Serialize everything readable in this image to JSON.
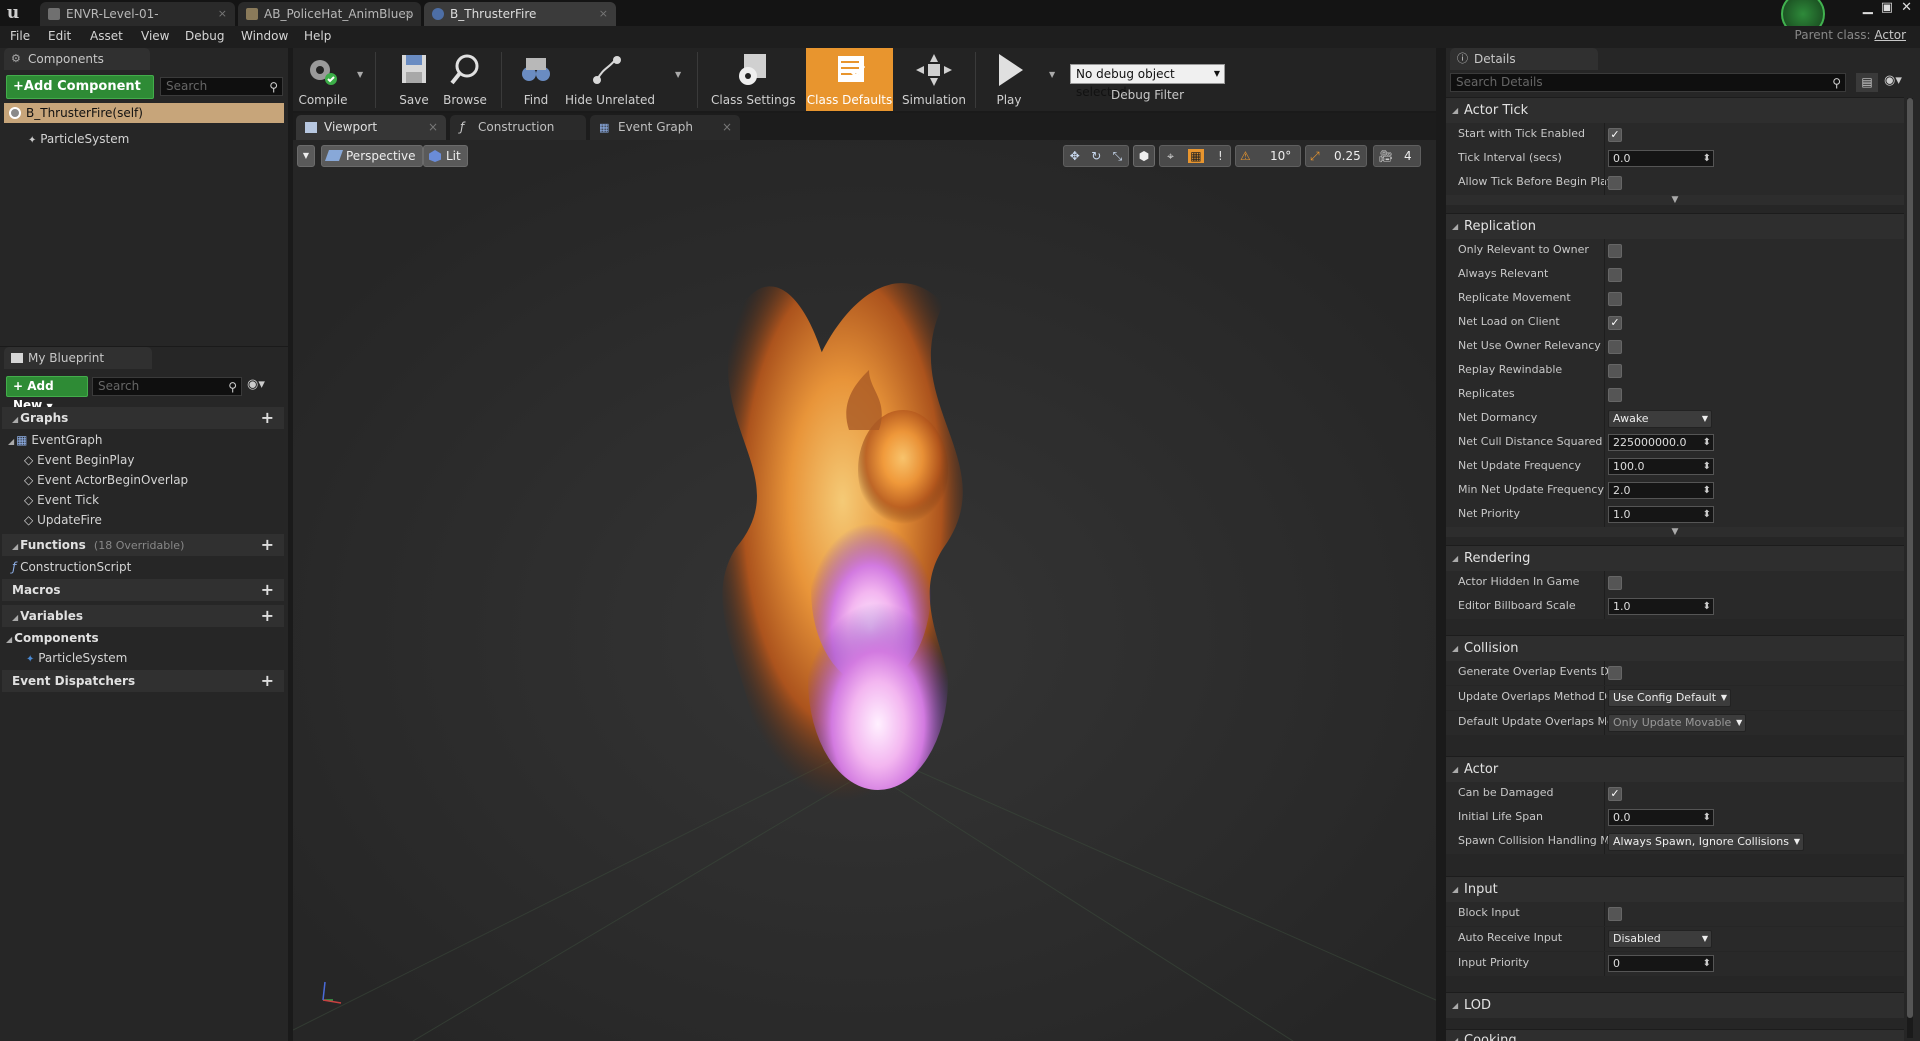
{
  "titlebar": {
    "tabs": [
      {
        "label": "ENVR-Level-01-"
      },
      {
        "label": "AB_PoliceHat_AnimBluep"
      },
      {
        "label": "B_ThrusterFire"
      }
    ],
    "parent_class_label": "Parent class:",
    "parent_class_value": "Actor"
  },
  "menu": [
    "File",
    "Edit",
    "Asset",
    "View",
    "Debug",
    "Window",
    "Help"
  ],
  "components_panel": {
    "tab": "Components",
    "add_button": "+Add Component",
    "search_placeholder": "Search",
    "root_item": "B_ThrusterFire(self)",
    "child_item": "ParticleSystem"
  },
  "my_blueprint": {
    "tab": "My Blueprint",
    "add_button": "Add New",
    "search_placeholder": "Search",
    "graphs_label": "Graphs",
    "event_graph": "EventGraph",
    "events": [
      "Event BeginPlay",
      "Event ActorBeginOverlap",
      "Event Tick",
      "UpdateFire"
    ],
    "functions_label": "Functions",
    "functions_count": "(18 Overridable)",
    "construction_script": "ConstructionScript",
    "macros_label": "Macros",
    "variables_label": "Variables",
    "components_label": "Components",
    "component_var": "ParticleSystem",
    "dispatchers_label": "Event Dispatchers"
  },
  "toolbar": {
    "compile": "Compile",
    "save": "Save",
    "browse": "Browse",
    "find": "Find",
    "hide_unrelated": "Hide Unrelated",
    "class_settings": "Class Settings",
    "class_defaults": "Class Defaults",
    "simulation": "Simulation",
    "play": "Play",
    "debug_object": "No debug object selected",
    "debug_filter": "Debug Filter"
  },
  "editor_tabs": [
    "Viewport",
    "Construction Scrip",
    "Event Graph"
  ],
  "viewport": {
    "perspective": "Perspective",
    "lit": "Lit",
    "angle_snap": "10°",
    "scale_snap": "0.25",
    "camera_speed": "4"
  },
  "details": {
    "tab": "Details",
    "search_placeholder": "Search Details",
    "sections": {
      "actor_tick": "Actor Tick",
      "replication": "Replication",
      "rendering": "Rendering",
      "collision": "Collision",
      "actor": "Actor",
      "input": "Input",
      "lod": "LOD",
      "cooking": "Cooking"
    },
    "actor_tick": {
      "start_with_tick": "Start with Tick Enabled",
      "tick_interval": "Tick Interval (secs)",
      "tick_interval_value": "0.0",
      "allow_tick": "Allow Tick Before Begin Play"
    },
    "replication": {
      "only_relevant": "Only Relevant to Owner",
      "always_relevant": "Always Relevant",
      "replicate_movement": "Replicate Movement",
      "net_load": "Net Load on Client",
      "net_use_owner": "Net Use Owner Relevancy",
      "replay_rewindable": "Replay Rewindable",
      "replicates": "Replicates",
      "net_dormancy": "Net Dormancy",
      "net_dormancy_value": "Awake",
      "net_cull": "Net Cull Distance Squared",
      "net_cull_value": "225000000.0",
      "net_update_freq": "Net Update Frequency",
      "net_update_freq_value": "100.0",
      "min_net_update": "Min Net Update Frequency",
      "min_net_update_value": "2.0",
      "net_priority": "Net Priority",
      "net_priority_value": "1.0"
    },
    "rendering": {
      "hidden": "Actor Hidden In Game",
      "billboard": "Editor Billboard Scale",
      "billboard_value": "1.0"
    },
    "collision": {
      "gen_overlap": "Generate Overlap Events Dur",
      "update_overlaps": "Update Overlaps Method Dur",
      "update_overlaps_value": "Use Config Default",
      "default_update": "Default Update Overlaps Met",
      "default_update_value": "Only Update Movable"
    },
    "actor": {
      "can_damage": "Can be Damaged",
      "life_span": "Initial Life Span",
      "life_span_value": "0.0",
      "spawn_collision": "Spawn Collision Handling Me",
      "spawn_collision_value": "Always Spawn, Ignore Collisions"
    },
    "input": {
      "block_input": "Block Input",
      "auto_receive": "Auto Receive Input",
      "auto_receive_value": "Disabled",
      "input_priority": "Input Priority",
      "input_priority_value": "0"
    }
  },
  "colors": {
    "accent_orange": "#e8952e",
    "add_green": "#2e8b35",
    "selection": "#c7a57a"
  }
}
